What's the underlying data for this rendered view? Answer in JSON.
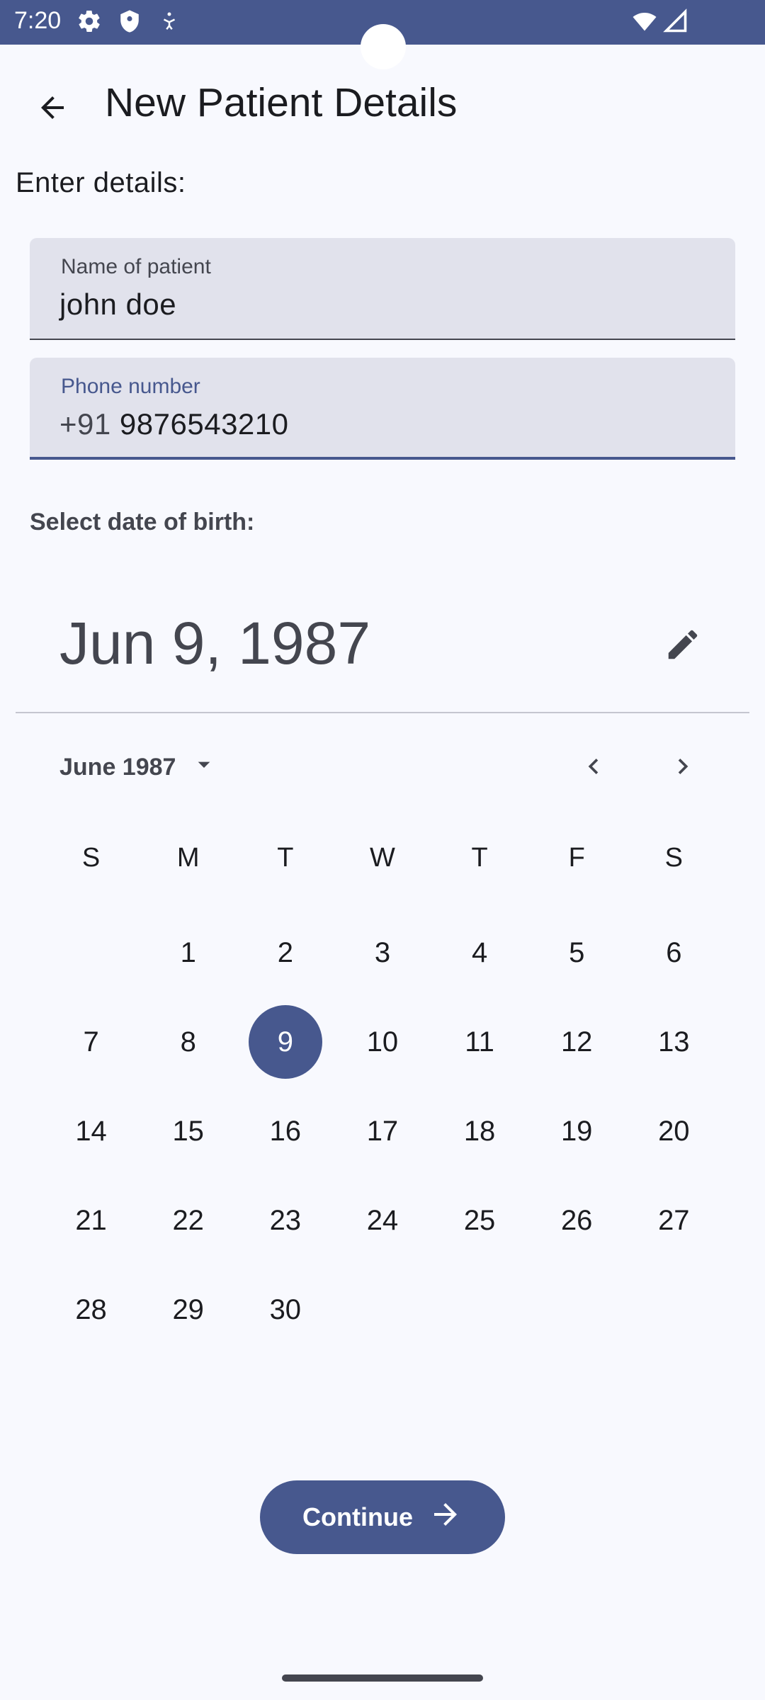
{
  "status_bar": {
    "time": "7:20",
    "left_icons": [
      "gear-icon",
      "shield-icon",
      "accessibility-icon"
    ],
    "right_icons": [
      "wifi-icon",
      "signal-icon"
    ]
  },
  "app_bar": {
    "title": "New Patient Details",
    "back_icon": "arrow-back-icon"
  },
  "form": {
    "section_label": "Enter details:",
    "name_field": {
      "label": "Name of patient",
      "value": "john doe"
    },
    "phone_field": {
      "label": "Phone number",
      "prefix": "+91",
      "value": "9876543210"
    }
  },
  "date_picker": {
    "label": "Select date of birth:",
    "headline": "Jun 9, 1987",
    "edit_icon": "pencil-icon",
    "month_year": "June 1987",
    "weekdays": [
      "S",
      "M",
      "T",
      "W",
      "T",
      "F",
      "S"
    ],
    "first_day_offset": 1,
    "days": [
      "1",
      "2",
      "3",
      "4",
      "5",
      "6",
      "7",
      "8",
      "9",
      "10",
      "11",
      "12",
      "13",
      "14",
      "15",
      "16",
      "17",
      "18",
      "19",
      "20",
      "21",
      "22",
      "23",
      "24",
      "25",
      "26",
      "27",
      "28",
      "29",
      "30"
    ],
    "selected_day": "9"
  },
  "continue_button": {
    "label": "Continue",
    "icon": "arrow-forward-icon"
  },
  "colors": {
    "primary": "#47588e",
    "background": "#f8f9fe",
    "field_bg": "#e1e2ec"
  }
}
